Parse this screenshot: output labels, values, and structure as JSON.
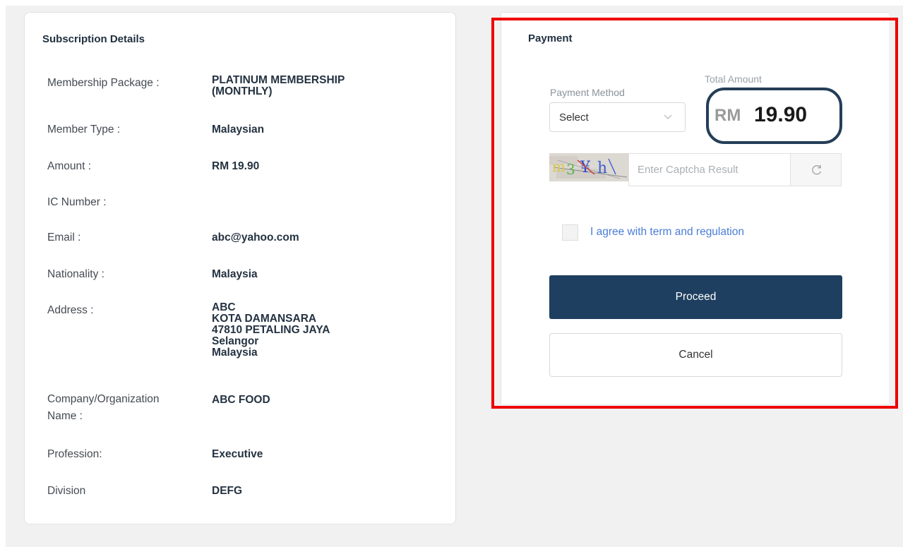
{
  "details": {
    "title": "Subscription Details",
    "rows": [
      {
        "label": "Membership Package :",
        "value": "PLATINUM MEMBERSHIP\n(MONTHLY)"
      },
      {
        "label": "Member Type :",
        "value": "Malaysian"
      },
      {
        "label": "Amount :",
        "value": "RM 19.90"
      },
      {
        "label": "IC Number :",
        "value": ""
      },
      {
        "label": "Email :",
        "value": "abc@yahoo.com"
      },
      {
        "label": "Nationality :",
        "value": "Malaysia"
      },
      {
        "label": "Address :",
        "value": "ABC\nKOTA DAMANSARA\n47810 PETALING JAYA\nSelangor\nMalaysia"
      },
      {
        "label": "Company/Organization\nName :",
        "value": "ABC FOOD"
      },
      {
        "label": "Profession:",
        "value": "Executive"
      },
      {
        "label": "Division",
        "value": "DEFG"
      }
    ]
  },
  "payment": {
    "title": "Payment",
    "method_label": "Payment Method",
    "method_selected": "Select",
    "total_label": "Total Amount",
    "total_currency": "RM",
    "total_value": "19.90",
    "captcha_text": "m3¥h",
    "captcha_placeholder": "Enter Captcha Result",
    "agree_text": "I agree with term and regulation",
    "proceed_label": "Proceed",
    "cancel_label": "Cancel"
  },
  "colors": {
    "primary": "#1f3f60",
    "highlight": "#ee0000",
    "link": "#4a7dd6"
  }
}
